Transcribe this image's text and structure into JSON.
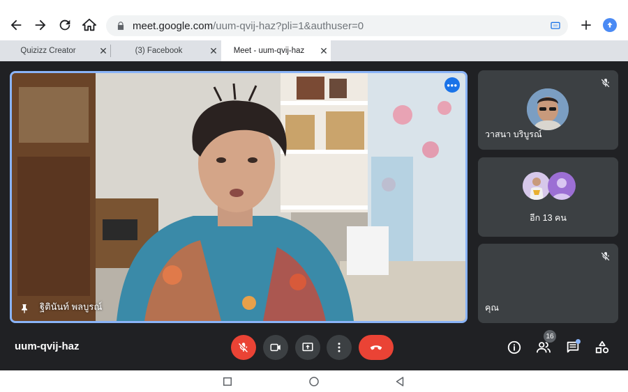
{
  "browser": {
    "url_host": "meet.google.com",
    "url_path": "/uum-qvij-haz?pli=1&authuser=0",
    "tabs": [
      {
        "label": "Quizizz Creator",
        "active": false
      },
      {
        "label": "(3) Facebook",
        "active": false
      },
      {
        "label": "Meet - uum-qvij-haz",
        "active": true
      }
    ],
    "icons": [
      "back-icon",
      "forward-icon",
      "reload-icon",
      "home-icon",
      "lock-icon",
      "cast-icon",
      "new-tab-icon",
      "profile-icon"
    ]
  },
  "meet": {
    "main_participant": {
      "name": "ฐิตินันท์ พลบูรณ์"
    },
    "side_tiles": [
      {
        "name": "วาสนา บริบูรณ์",
        "muted": true
      },
      {
        "label": "อีก 13 คน"
      },
      {
        "name": "คุณ",
        "muted": true
      }
    ],
    "meeting_code": "uum-qvij-haz",
    "participants_count": "16",
    "colors": {
      "background": "#202124",
      "tile": "#3c4043",
      "accent": "#8ab4f8",
      "danger": "#ea4335"
    }
  }
}
